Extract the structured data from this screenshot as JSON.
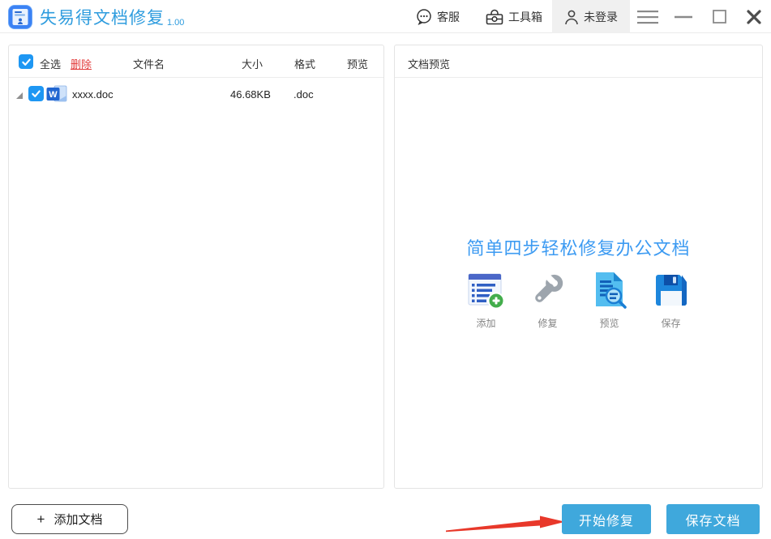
{
  "window": {
    "title": "失易得文档修复",
    "version": "1.00",
    "titlebar": {
      "customer_service": "客服",
      "toolbox": "工具箱",
      "login_status": "未登录"
    }
  },
  "file_panel": {
    "select_all": "全选",
    "delete_label": "删除",
    "columns": {
      "name": "文件名",
      "size": "大小",
      "format": "格式",
      "preview": "预览"
    },
    "files": [
      {
        "name": "xxxx.doc",
        "size": "46.68KB",
        "format": ".doc"
      }
    ]
  },
  "preview_panel": {
    "header": "文档预览",
    "slogan": "简单四步轻松修复办公文档",
    "steps": [
      {
        "label": "添加",
        "icon": "add-document-icon"
      },
      {
        "label": "修复",
        "icon": "repair-wrench-icon"
      },
      {
        "label": "预览",
        "icon": "preview-document-icon"
      },
      {
        "label": "保存",
        "icon": "save-floppy-icon"
      }
    ]
  },
  "footer": {
    "add_plus": "+",
    "add_document": "添加文档",
    "start_repair": "开始修复",
    "save_document": "保存文档"
  },
  "icons": {
    "word_glyph": "W"
  },
  "colors": {
    "title_blue": "#2E9CDE",
    "slogan_blue": "#3D9BF2",
    "button_blue": "#3FA8DC",
    "checkbox_blue": "#1E97F3",
    "delete_red": "#E23B3B",
    "arrow_red": "#E8382A",
    "login_bg": "#F0F0F0"
  }
}
